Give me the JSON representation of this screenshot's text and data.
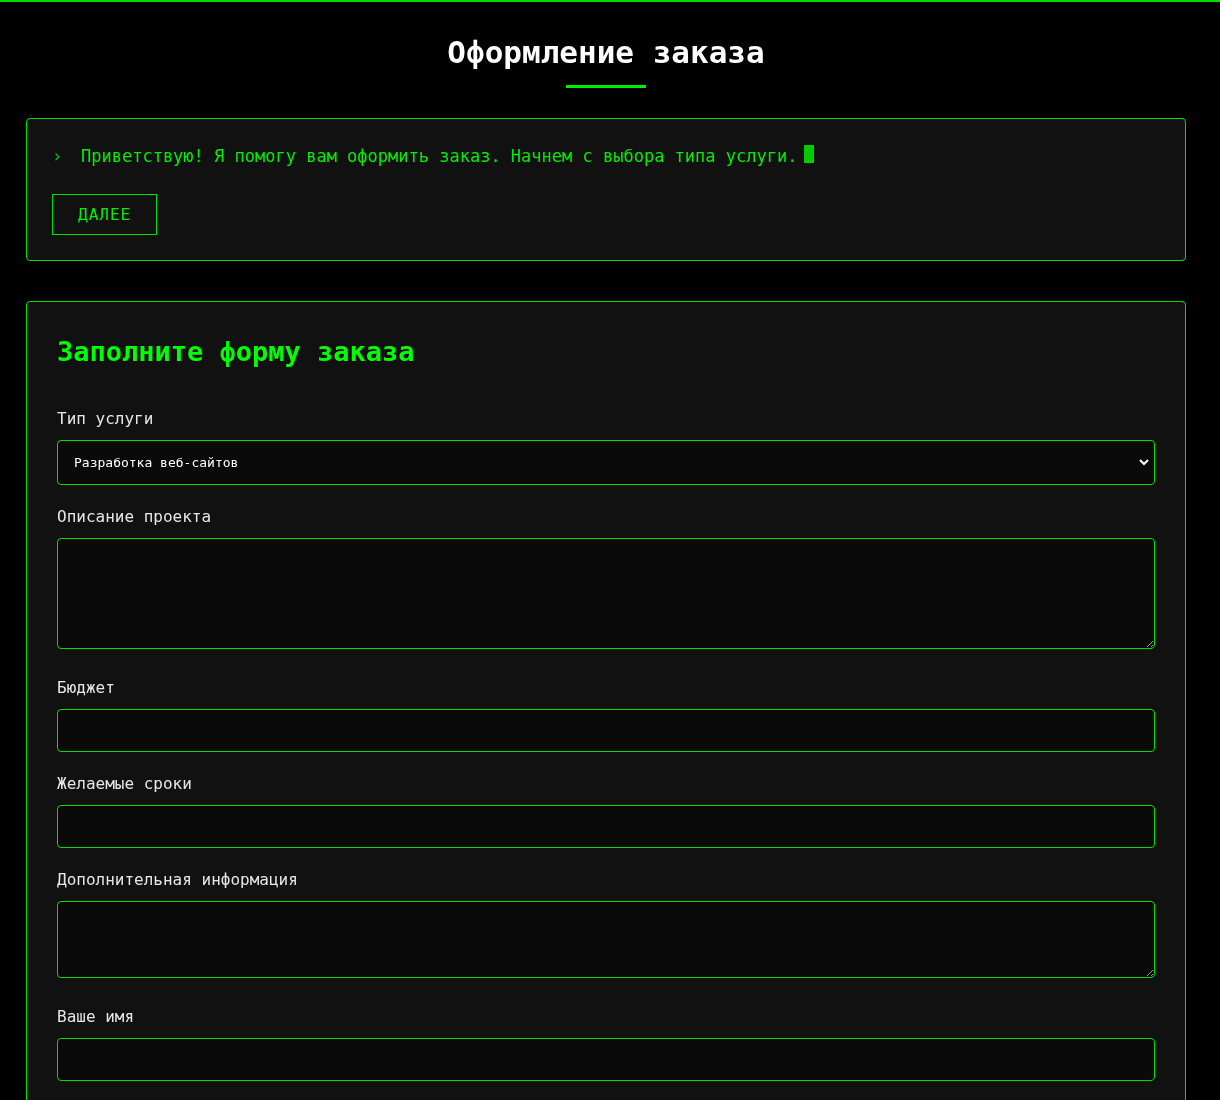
{
  "page": {
    "title": "Оформление заказа"
  },
  "chat": {
    "prompt": "›",
    "message": "Приветствую! Я помогу вам оформить заказ. Начнем с выбора типа услуги.",
    "button": "ДАЛЕЕ"
  },
  "form": {
    "title": "Заполните форму заказа",
    "fields": [
      {
        "kind": "select",
        "label": "Тип услуги",
        "value": "Разработка веб-сайтов"
      },
      {
        "kind": "textarea",
        "label": "Описание проекта"
      },
      {
        "kind": "input",
        "label": "Бюджет"
      },
      {
        "kind": "input",
        "label": "Желаемые сроки"
      },
      {
        "kind": "textarea",
        "label": "Дополнительная информация"
      },
      {
        "kind": "input",
        "label": "Ваше имя"
      }
    ]
  }
}
